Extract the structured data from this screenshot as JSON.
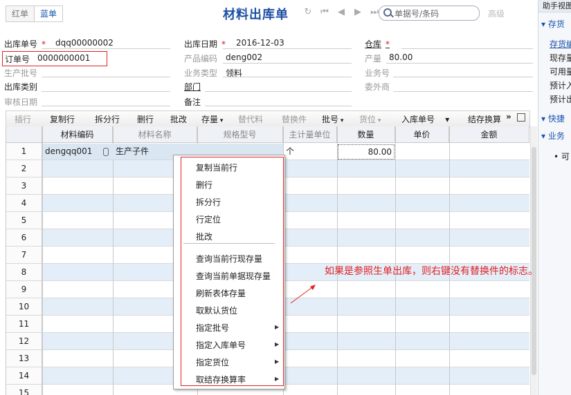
{
  "tabs": {
    "red": "红单",
    "blue": "蓝单"
  },
  "title": "材料出库单",
  "search": {
    "placeholder": "单据号/条码"
  },
  "advanced": "高级",
  "form": {
    "doc_no_label": "出库单号",
    "doc_no_value": "dqq00000002",
    "order_no_label": "订单号",
    "order_no_value": "0000000001",
    "batch_label": "生产批号",
    "out_type_label": "出库类别",
    "audit_date_label": "审核日期",
    "out_date_label": "出库日期",
    "out_date_value": "2016-12-03",
    "product_code_label": "产品编码",
    "product_code_value": "deng002",
    "biz_type_label": "业务类型",
    "biz_type_value": "领料",
    "dept_label": "部门",
    "remark_label": "备注",
    "warehouse_label": "仓库",
    "output_label": "产量",
    "output_value": "80.00",
    "biz_no_label": "业务号",
    "outsource_label": "委外商",
    "required_mark": "*"
  },
  "toolbar": {
    "insert": "插行",
    "copy": "复制行",
    "split": "拆分行",
    "delete": "删行",
    "batch_edit": "批改",
    "stock": "存量",
    "subst": "替代料",
    "replace": "替换件",
    "batch_no": "批号",
    "location": "货位",
    "inbound_no": "入库单号",
    "settle": "结存换算",
    "more": "»"
  },
  "table": {
    "headers": [
      "材料编码",
      "材料名称",
      "规格型号",
      "主计量单位",
      "数量",
      "单价",
      "金额"
    ],
    "row_numbers": [
      "1",
      "2",
      "3",
      "4",
      "5",
      "6",
      "7",
      "8",
      "9",
      "10",
      "11",
      "12",
      "13",
      "14",
      "15"
    ],
    "row1": {
      "code": "dengqq001",
      "name": "生产子件",
      "unit": "个",
      "qty": "80.00"
    }
  },
  "right_panel": {
    "header": "助手视图",
    "sec1": "存货",
    "sec1_link": "存货编",
    "items": [
      "现存量",
      "可用量",
      "预计入",
      "预计出"
    ],
    "sec2": "快捷",
    "sec3": "业务",
    "bullet": "可"
  },
  "context_menu": {
    "group1": [
      "复制当前行",
      "删行",
      "拆分行",
      "行定位",
      "批改"
    ],
    "group2": [
      "查询当前行现存量",
      "查询当前单据现存量",
      "刷新表体存量",
      "取默认货位"
    ],
    "submenus": [
      "指定批号",
      "指定入库单号",
      "指定货位",
      "取结存换算率"
    ]
  },
  "annotation": "如果是参照生单出库，则右键没有替换件的标志。",
  "colors": {
    "accent": "#1d4fa6",
    "highlight": "#e02020",
    "row_alt": "#e4eef9"
  }
}
